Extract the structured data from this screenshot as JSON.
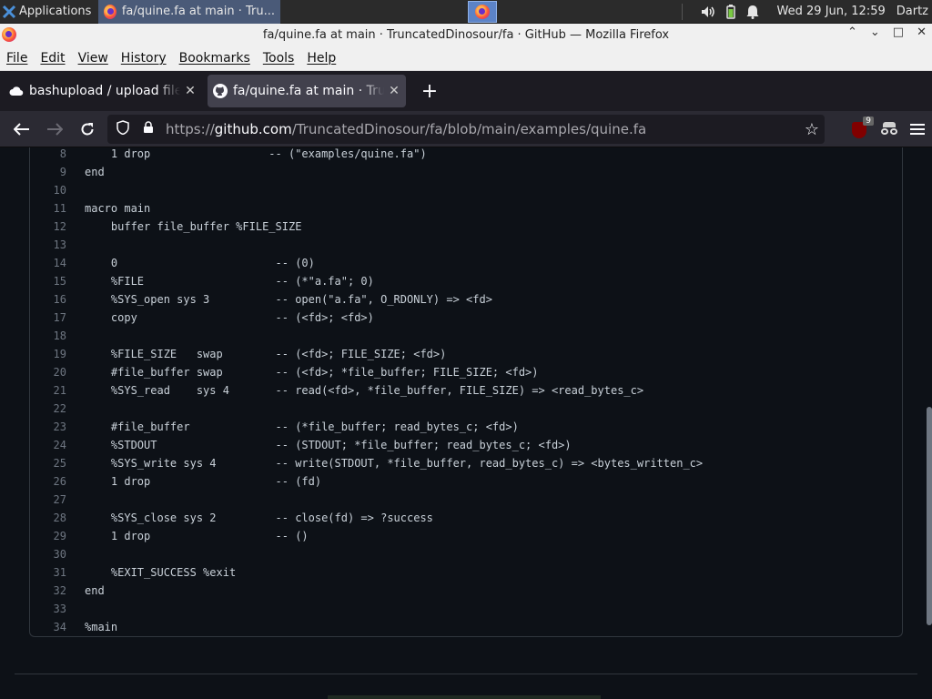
{
  "taskbar": {
    "applications_label": "Applications",
    "task_title": "fa/quine.fa at main · Tru...",
    "clock": "Wed 29 Jun, 12:59",
    "user": "Dartz"
  },
  "window": {
    "title": "fa/quine.fa at main · TruncatedDinosour/fa · GitHub — Mozilla Firefox"
  },
  "menu": [
    "File",
    "Edit",
    "View",
    "History",
    "Bookmarks",
    "Tools",
    "Help"
  ],
  "tabs": [
    {
      "title": "bashupload / upload files",
      "active": false
    },
    {
      "title": "fa/quine.fa at main · TruncatedDinosour/fa · GitHub",
      "active": true
    }
  ],
  "urlbar": {
    "scheme": "https://",
    "host": "github.com",
    "path": "/TruncatedDinosour/fa/blob/main/examples/quine.fa"
  },
  "extensions": {
    "ublock_badge": "9"
  },
  "code": [
    {
      "n": "8",
      "text": "    1 drop                  -- (\"examples/quine.fa\")"
    },
    {
      "n": "9",
      "text": "end"
    },
    {
      "n": "10",
      "text": ""
    },
    {
      "n": "11",
      "text": "macro main"
    },
    {
      "n": "12",
      "text": "    buffer file_buffer %FILE_SIZE"
    },
    {
      "n": "13",
      "text": ""
    },
    {
      "n": "14",
      "text": "    0                        -- (0)"
    },
    {
      "n": "15",
      "text": "    %FILE                    -- (*\"a.fa\"; 0)"
    },
    {
      "n": "16",
      "text": "    %SYS_open sys 3          -- open(\"a.fa\", O_RDONLY) => <fd>"
    },
    {
      "n": "17",
      "text": "    copy                     -- (<fd>; <fd>)"
    },
    {
      "n": "18",
      "text": ""
    },
    {
      "n": "19",
      "text": "    %FILE_SIZE   swap        -- (<fd>; FILE_SIZE; <fd>)"
    },
    {
      "n": "20",
      "text": "    #file_buffer swap        -- (<fd>; *file_buffer; FILE_SIZE; <fd>)"
    },
    {
      "n": "21",
      "text": "    %SYS_read    sys 4       -- read(<fd>, *file_buffer, FILE_SIZE) => <read_bytes_c>"
    },
    {
      "n": "22",
      "text": ""
    },
    {
      "n": "23",
      "text": "    #file_buffer             -- (*file_buffer; read_bytes_c; <fd>)"
    },
    {
      "n": "24",
      "text": "    %STDOUT                  -- (STDOUT; *file_buffer; read_bytes_c; <fd>)"
    },
    {
      "n": "25",
      "text": "    %SYS_write sys 4         -- write(STDOUT, *file_buffer, read_bytes_c) => <bytes_written_c>"
    },
    {
      "n": "26",
      "text": "    1 drop                   -- (fd)"
    },
    {
      "n": "27",
      "text": ""
    },
    {
      "n": "28",
      "text": "    %SYS_close sys 2         -- close(fd) => ?success"
    },
    {
      "n": "29",
      "text": "    1 drop                   -- ()"
    },
    {
      "n": "30",
      "text": ""
    },
    {
      "n": "31",
      "text": "    %EXIT_SUCCESS %exit"
    },
    {
      "n": "32",
      "text": "end"
    },
    {
      "n": "33",
      "text": ""
    },
    {
      "n": "34",
      "text": "%main"
    }
  ]
}
